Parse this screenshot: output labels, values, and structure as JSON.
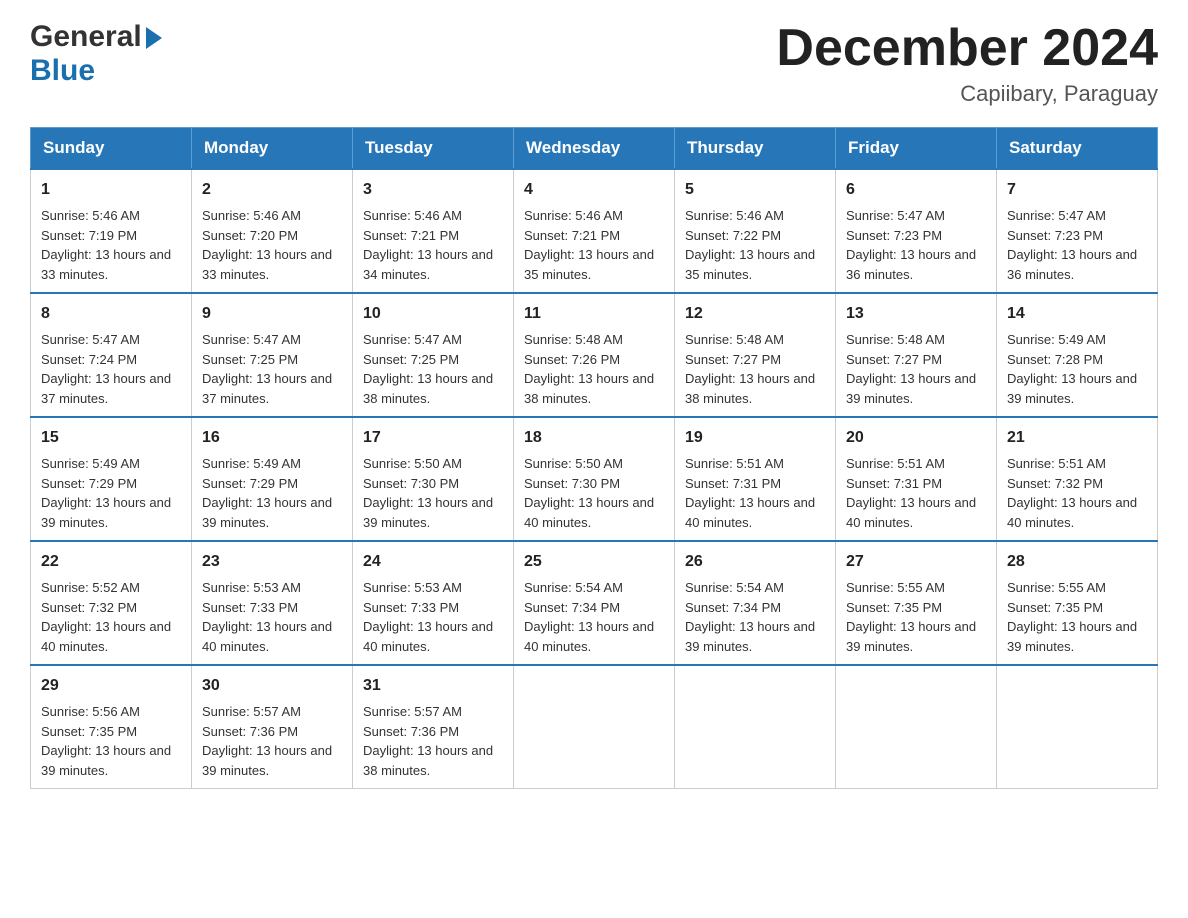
{
  "logo": {
    "general": "General",
    "blue": "Blue",
    "arrow": "▶"
  },
  "title": "December 2024",
  "location": "Capiibary, Paraguay",
  "days_of_week": [
    "Sunday",
    "Monday",
    "Tuesday",
    "Wednesday",
    "Thursday",
    "Friday",
    "Saturday"
  ],
  "weeks": [
    [
      {
        "day": "1",
        "sunrise": "5:46 AM",
        "sunset": "7:19 PM",
        "daylight": "13 hours and 33 minutes."
      },
      {
        "day": "2",
        "sunrise": "5:46 AM",
        "sunset": "7:20 PM",
        "daylight": "13 hours and 33 minutes."
      },
      {
        "day": "3",
        "sunrise": "5:46 AM",
        "sunset": "7:21 PM",
        "daylight": "13 hours and 34 minutes."
      },
      {
        "day": "4",
        "sunrise": "5:46 AM",
        "sunset": "7:21 PM",
        "daylight": "13 hours and 35 minutes."
      },
      {
        "day": "5",
        "sunrise": "5:46 AM",
        "sunset": "7:22 PM",
        "daylight": "13 hours and 35 minutes."
      },
      {
        "day": "6",
        "sunrise": "5:47 AM",
        "sunset": "7:23 PM",
        "daylight": "13 hours and 36 minutes."
      },
      {
        "day": "7",
        "sunrise": "5:47 AM",
        "sunset": "7:23 PM",
        "daylight": "13 hours and 36 minutes."
      }
    ],
    [
      {
        "day": "8",
        "sunrise": "5:47 AM",
        "sunset": "7:24 PM",
        "daylight": "13 hours and 37 minutes."
      },
      {
        "day": "9",
        "sunrise": "5:47 AM",
        "sunset": "7:25 PM",
        "daylight": "13 hours and 37 minutes."
      },
      {
        "day": "10",
        "sunrise": "5:47 AM",
        "sunset": "7:25 PM",
        "daylight": "13 hours and 38 minutes."
      },
      {
        "day": "11",
        "sunrise": "5:48 AM",
        "sunset": "7:26 PM",
        "daylight": "13 hours and 38 minutes."
      },
      {
        "day": "12",
        "sunrise": "5:48 AM",
        "sunset": "7:27 PM",
        "daylight": "13 hours and 38 minutes."
      },
      {
        "day": "13",
        "sunrise": "5:48 AM",
        "sunset": "7:27 PM",
        "daylight": "13 hours and 39 minutes."
      },
      {
        "day": "14",
        "sunrise": "5:49 AM",
        "sunset": "7:28 PM",
        "daylight": "13 hours and 39 minutes."
      }
    ],
    [
      {
        "day": "15",
        "sunrise": "5:49 AM",
        "sunset": "7:29 PM",
        "daylight": "13 hours and 39 minutes."
      },
      {
        "day": "16",
        "sunrise": "5:49 AM",
        "sunset": "7:29 PM",
        "daylight": "13 hours and 39 minutes."
      },
      {
        "day": "17",
        "sunrise": "5:50 AM",
        "sunset": "7:30 PM",
        "daylight": "13 hours and 39 minutes."
      },
      {
        "day": "18",
        "sunrise": "5:50 AM",
        "sunset": "7:30 PM",
        "daylight": "13 hours and 40 minutes."
      },
      {
        "day": "19",
        "sunrise": "5:51 AM",
        "sunset": "7:31 PM",
        "daylight": "13 hours and 40 minutes."
      },
      {
        "day": "20",
        "sunrise": "5:51 AM",
        "sunset": "7:31 PM",
        "daylight": "13 hours and 40 minutes."
      },
      {
        "day": "21",
        "sunrise": "5:51 AM",
        "sunset": "7:32 PM",
        "daylight": "13 hours and 40 minutes."
      }
    ],
    [
      {
        "day": "22",
        "sunrise": "5:52 AM",
        "sunset": "7:32 PM",
        "daylight": "13 hours and 40 minutes."
      },
      {
        "day": "23",
        "sunrise": "5:53 AM",
        "sunset": "7:33 PM",
        "daylight": "13 hours and 40 minutes."
      },
      {
        "day": "24",
        "sunrise": "5:53 AM",
        "sunset": "7:33 PM",
        "daylight": "13 hours and 40 minutes."
      },
      {
        "day": "25",
        "sunrise": "5:54 AM",
        "sunset": "7:34 PM",
        "daylight": "13 hours and 40 minutes."
      },
      {
        "day": "26",
        "sunrise": "5:54 AM",
        "sunset": "7:34 PM",
        "daylight": "13 hours and 39 minutes."
      },
      {
        "day": "27",
        "sunrise": "5:55 AM",
        "sunset": "7:35 PM",
        "daylight": "13 hours and 39 minutes."
      },
      {
        "day": "28",
        "sunrise": "5:55 AM",
        "sunset": "7:35 PM",
        "daylight": "13 hours and 39 minutes."
      }
    ],
    [
      {
        "day": "29",
        "sunrise": "5:56 AM",
        "sunset": "7:35 PM",
        "daylight": "13 hours and 39 minutes."
      },
      {
        "day": "30",
        "sunrise": "5:57 AM",
        "sunset": "7:36 PM",
        "daylight": "13 hours and 39 minutes."
      },
      {
        "day": "31",
        "sunrise": "5:57 AM",
        "sunset": "7:36 PM",
        "daylight": "13 hours and 38 minutes."
      },
      null,
      null,
      null,
      null
    ]
  ]
}
